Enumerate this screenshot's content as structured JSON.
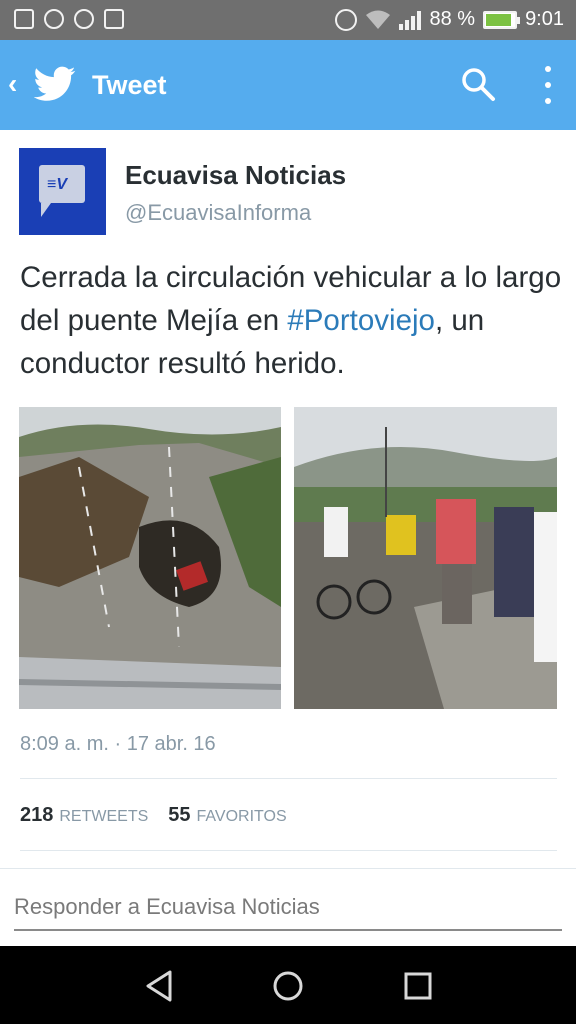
{
  "status_bar": {
    "battery_percent": "88 %",
    "time": "9:01",
    "notification_icons": [
      "facebook-icon",
      "whatsapp-icon",
      "whatsapp-icon",
      "image-icon"
    ],
    "system_icons": [
      "alarm-icon",
      "wifi-icon",
      "signal-icon",
      "battery-charging-icon"
    ]
  },
  "app_bar": {
    "title": "Tweet",
    "brand_color": "#55acee"
  },
  "tweet": {
    "author_name": "Ecuavisa Noticias",
    "author_handle": "@EcuavisaInforma",
    "text_before": "Cerrada la circulación vehicular a lo largo del puente Mejía en ",
    "hashtag": "#Portoviejo",
    "text_after": ", un conductor resultó herido.",
    "timestamp": "8:09 a. m. · 17 abr. 16",
    "retweets_count": "218",
    "retweets_label": "RETWEETS",
    "favorites_count": "55",
    "favorites_label": "FAVORITOS"
  },
  "reply": {
    "placeholder": "Responder a Ecuavisa Noticias"
  },
  "nav_bar": {
    "icons": [
      "back-triangle-icon",
      "home-circle-icon",
      "recents-square-icon"
    ]
  }
}
